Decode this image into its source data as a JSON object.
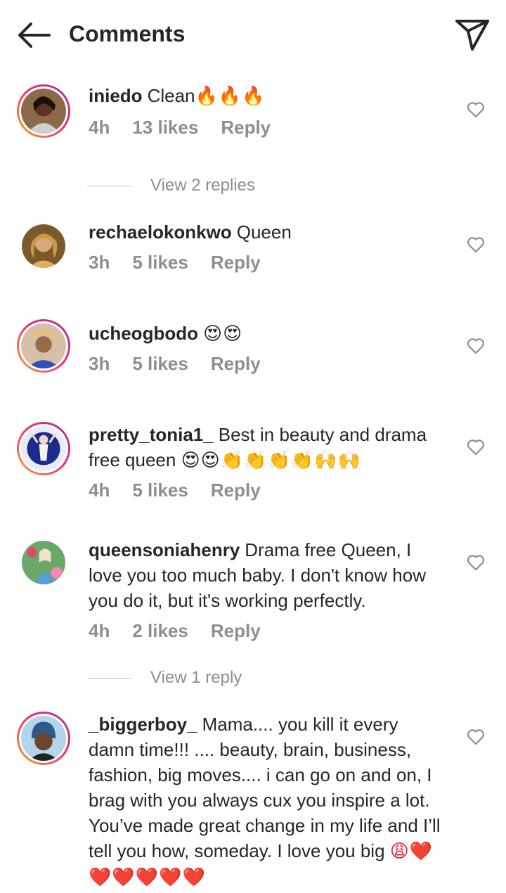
{
  "header": {
    "title": "Comments",
    "back_icon": "arrow-left-icon",
    "share_icon": "paper-plane-icon"
  },
  "colors": {
    "text": "#262626",
    "muted": "#8e8e8e",
    "heart_red": "#ef1b3c",
    "story_ring": [
      "#f9a825",
      "#ee2a7b",
      "#8a3ab9"
    ]
  },
  "comments": [
    {
      "username": "iniedo",
      "text": "Clean",
      "emoji": "🔥🔥🔥",
      "time": "4h",
      "likes": "13 likes",
      "reply": "Reply",
      "view_replies": "View 2 replies"
    },
    {
      "username": "rechaelokonkwo",
      "text": "Queen",
      "emoji": "",
      "time": "3h",
      "likes": "5 likes",
      "reply": "Reply"
    },
    {
      "username": "ucheogbodo",
      "text": "",
      "emoji": "😍😍",
      "time": "3h",
      "likes": "5 likes",
      "reply": "Reply"
    },
    {
      "username": "pretty_tonia1_",
      "text": "Best in beauty and drama free queen",
      "emoji": "😍😍👏👏👏👏🙌🙌",
      "time": "4h",
      "likes": "5 likes",
      "reply": "Reply"
    },
    {
      "username": "queensoniahenry",
      "text": "Drama free Queen, I love you too much baby. I don't know how you do it, but it's working perfectly.",
      "emoji": "",
      "time": "4h",
      "likes": "2 likes",
      "reply": "Reply",
      "view_replies": "View 1 reply"
    },
    {
      "username": "_biggerboy_",
      "text": "Mama.... you kill it every damn time!!! .... beauty, brain, business, fashion, big moves.... i can go on and on, I brag with you always cux you inspire a lot. You’ve made great change in my life and I’ll tell you how, someday. I love you big",
      "emoji": "😩❤️❤️❤️❤️❤️❤️"
    }
  ]
}
